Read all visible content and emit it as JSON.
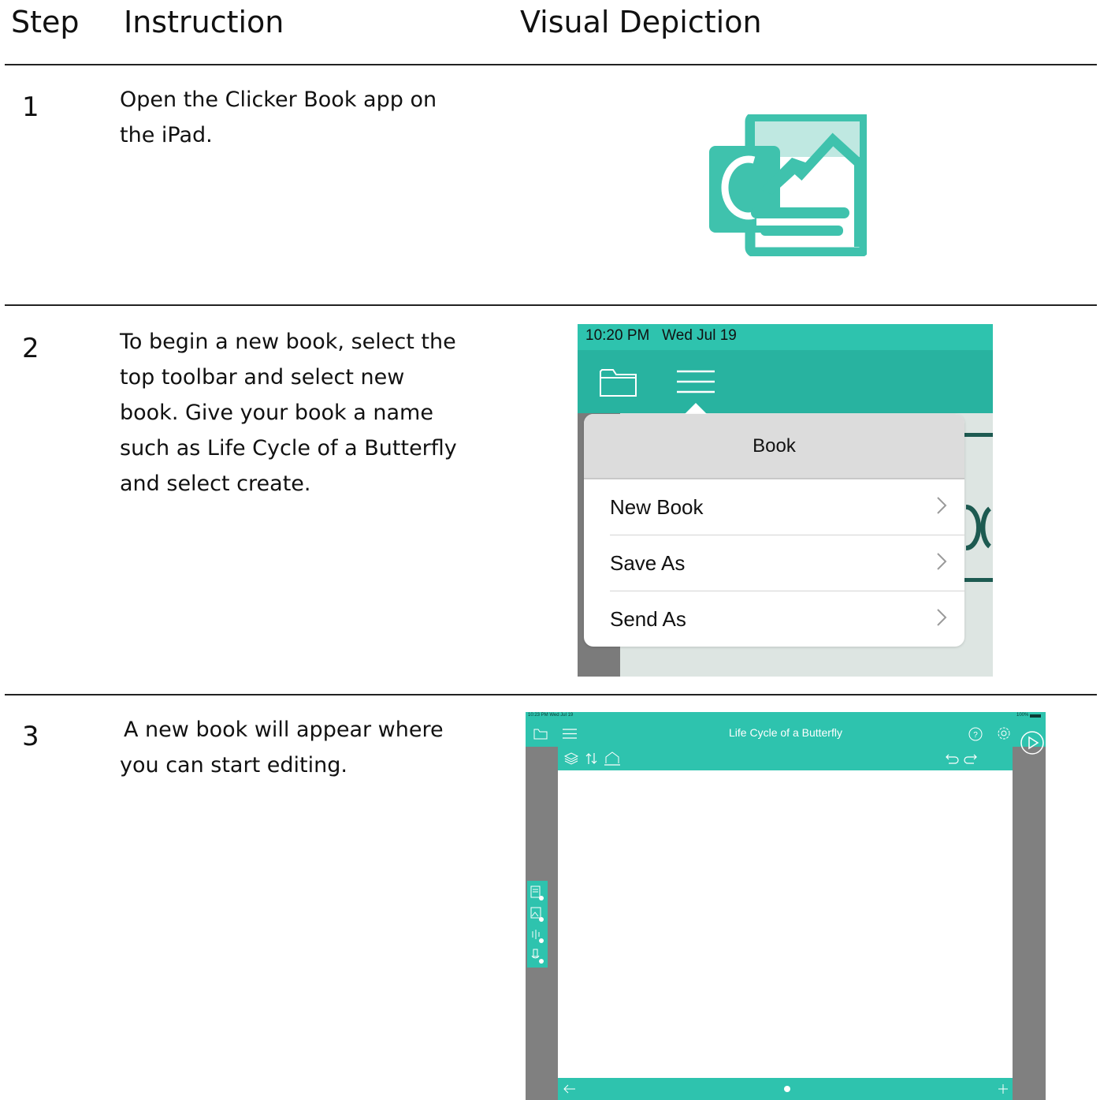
{
  "headers": {
    "step": "Step",
    "instruction": "Instruction",
    "visual": "Visual Depiction"
  },
  "rows": [
    {
      "step": "1",
      "instruction": "Open the Clicker Book app on the iPad."
    },
    {
      "step": "2",
      "instruction": "To begin a new book, select the top toolbar and select new book. Give your book a name such as Life Cycle of a Butterfly and select create."
    },
    {
      "step": "3",
      "instruction": "A new book will appear where you can start editing."
    }
  ],
  "app_icon": {
    "name": "clicker-book-app-icon",
    "color": "#2ec3ae"
  },
  "screenshot2": {
    "status": "10:20 PM   Wed Jul 19",
    "menu_title": "Book",
    "menu_items": [
      "New Book",
      "Save As",
      "Send As"
    ],
    "accent": "#2ec3ae"
  },
  "screenshot3": {
    "status_time": "10:23 PM  Wed Jul 19",
    "battery": "100%",
    "title": "Life Cycle of a Butterfly",
    "accent": "#2ec3ae"
  }
}
